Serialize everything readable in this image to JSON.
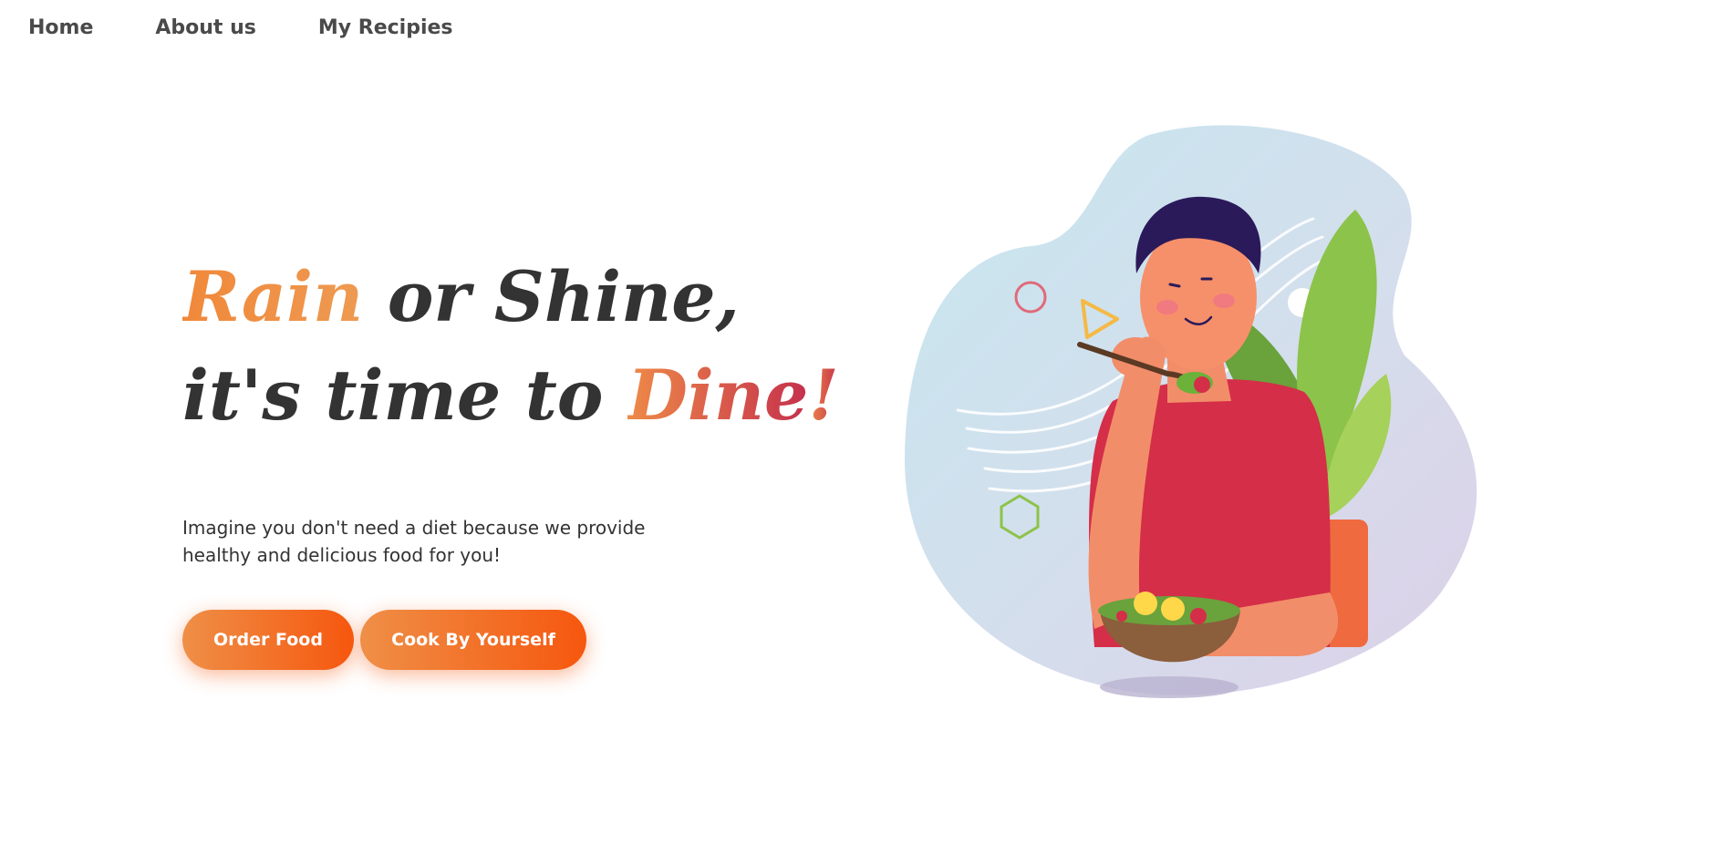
{
  "nav": {
    "items": [
      {
        "label": "Home"
      },
      {
        "label": "About us"
      },
      {
        "label": "My Recipies"
      }
    ]
  },
  "hero": {
    "headline": {
      "line1_accent": "Rain",
      "line1_rest": " or Shine,",
      "line2_start": "it's time to ",
      "line2_accent": "Dine",
      "line2_end": "!"
    },
    "description": "Imagine you don't need a diet because we provide healthy and delicious food for you!",
    "buttons": {
      "order_label": "Order Food",
      "cook_label": "Cook By Yourself"
    }
  },
  "colors": {
    "accent_orange": "#f0883a",
    "accent_red": "#c5304d",
    "button_gradient_start": "#ef8f47",
    "button_gradient_end": "#f6570e",
    "text_dark": "#333333"
  }
}
